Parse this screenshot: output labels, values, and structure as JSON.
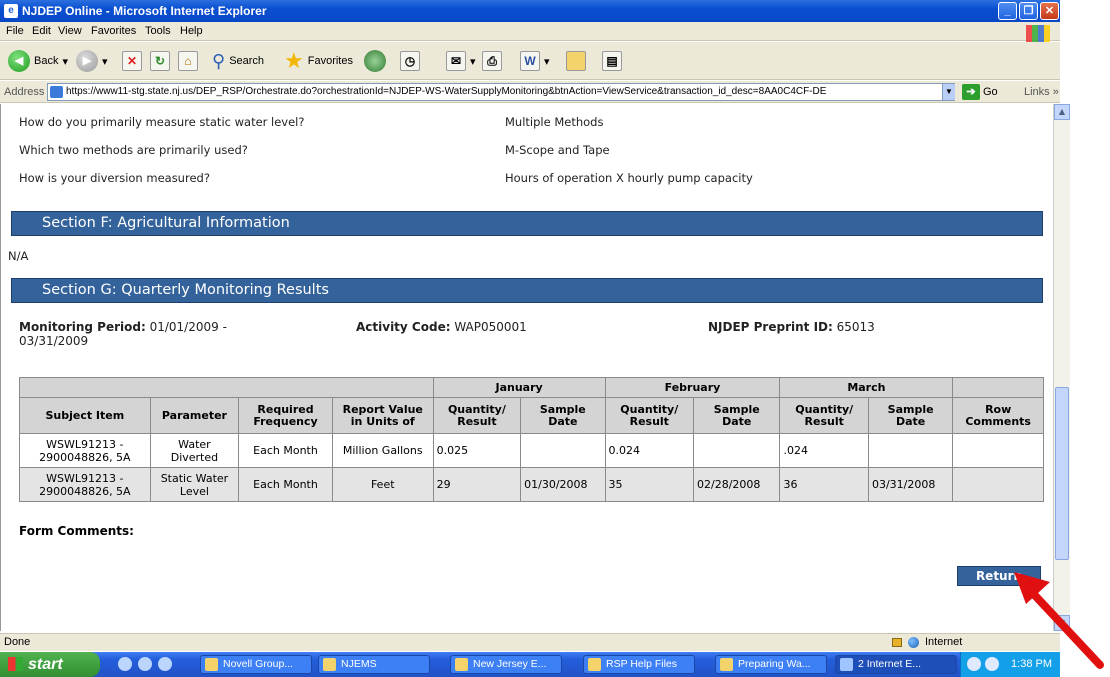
{
  "window": {
    "title": "NJDEP Online - Microsoft Internet Explorer"
  },
  "menu": [
    "File",
    "Edit",
    "View",
    "Favorites",
    "Tools",
    "Help"
  ],
  "toolbar": {
    "back": "Back",
    "search": "Search",
    "favorites": "Favorites"
  },
  "address": {
    "label": "Address",
    "url": "https://www11-stg.state.nj.us/DEP_RSP/Orchestrate.do?orchestrationId=NJDEP-WS-WaterSupplyMonitoring&btnAction=ViewService&transaction_id_desc=8AA0C4CF-DE",
    "go": "Go",
    "links": "Links"
  },
  "qa": [
    {
      "q": "How do you primarily measure static water level?",
      "a": "Multiple Methods"
    },
    {
      "q": "Which two methods are primarily used?",
      "a": "M-Scope and Tape"
    },
    {
      "q": "How is your diversion measured?",
      "a": "Hours of operation X hourly pump capacity"
    }
  ],
  "section_f": {
    "title": "Section F: Agricultural Information",
    "body": "N/A"
  },
  "section_g": {
    "title": "Section G: Quarterly Monitoring Results",
    "monitoring_period_label": "Monitoring Period:",
    "monitoring_period_value": "01/01/2009 -",
    "monitoring_period_value2": "03/31/2009",
    "activity_code_label": "Activity Code:",
    "activity_code_value": "WAP050001",
    "preprint_label": "NJDEP Preprint ID:",
    "preprint_value": "65013"
  },
  "table": {
    "months": [
      "January",
      "February",
      "March"
    ],
    "headers": {
      "subject": "Subject Item",
      "parameter": "Parameter",
      "frequency_1": "Required",
      "frequency_2": "Frequency",
      "units_1": "Report Value",
      "units_2": "in Units of",
      "qty_1": "Quantity/",
      "qty_2": "Result",
      "date_1": "Sample",
      "date_2": "Date",
      "comments_1": "Row",
      "comments_2": "Comments"
    },
    "rows": [
      {
        "subject_1": "WSWL91213 -",
        "subject_2": "2900048826, 5A",
        "param_1": "Water",
        "param_2": "Diverted",
        "frequency": "Each Month",
        "units": "Million Gallons",
        "jan_qty": "0.025",
        "jan_date": "",
        "feb_qty": "0.024",
        "feb_date": "",
        "mar_qty": ".024",
        "mar_date": "",
        "comments": ""
      },
      {
        "subject_1": "WSWL91213 -",
        "subject_2": "2900048826, 5A",
        "param_1": "Static Water",
        "param_2": "Level",
        "frequency": "Each Month",
        "units": "Feet",
        "jan_qty": "29",
        "jan_date": "01/30/2008",
        "feb_qty": "35",
        "feb_date": "02/28/2008",
        "mar_qty": "36",
        "mar_date": "03/31/2008",
        "comments": ""
      }
    ]
  },
  "form_comments_label": "Form Comments:",
  "return_button": "Return",
  "status": {
    "text": "Done",
    "zone": "Internet"
  },
  "taskbar": {
    "start": "start",
    "tasks": [
      "Novell Group...",
      "NJEMS",
      "New Jersey E...",
      "RSP Help Files",
      "Preparing Wa...",
      "2 Internet E..."
    ],
    "clock": "1:38 PM"
  },
  "colors": {
    "section_header": "#34639c",
    "title_bar": "#0a4fd1",
    "annotation_arrow": "#e01010"
  }
}
